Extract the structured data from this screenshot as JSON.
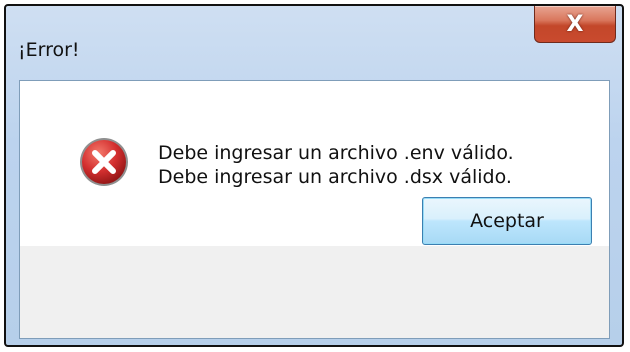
{
  "dialog": {
    "title": "¡Error!",
    "close_label": "X",
    "messages": [
      "Debe ingresar un archivo .env válido.",
      "Debe ingresar un archivo .dsx válido."
    ],
    "ok_label": "Aceptar",
    "icon": "error-icon"
  },
  "colors": {
    "error_icon": "#d32f2f",
    "close_button": "#c94a2e",
    "ok_button_border": "#3c7fb1"
  }
}
